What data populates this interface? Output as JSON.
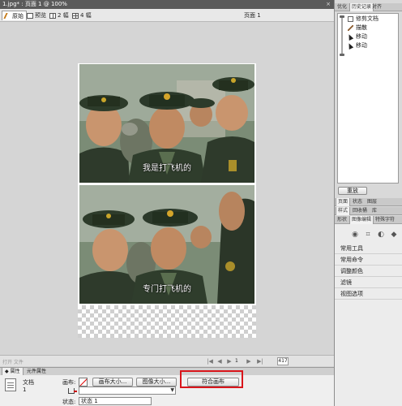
{
  "window": {
    "title": "1.jpg* : 页面 1 @ 100%",
    "close": "×"
  },
  "view_tabs": [
    {
      "label": "原始",
      "icon": "pen-icon",
      "active": true
    },
    {
      "label": "预览",
      "icon": "preview-icon"
    },
    {
      "label": "2 幅",
      "icon": "two-up-icon"
    },
    {
      "label": "4 幅",
      "icon": "four-up-icon"
    }
  ],
  "page_label": "页面 1",
  "canvas": {
    "photos": [
      {
        "caption": "我是打飞机的"
      },
      {
        "caption": "专门打飞机的"
      }
    ]
  },
  "status": {
    "left": "打开 文件",
    "page_number": "1",
    "zoom": "417",
    "nav_first": "|◀",
    "nav_prev": "◀",
    "nav_play": "▶",
    "nav_next": "▶",
    "nav_last": "▶|"
  },
  "properties": {
    "tabs": [
      {
        "label": "◆ 属性",
        "active": true
      },
      {
        "label": "元件属性"
      }
    ],
    "doc_type": "文档",
    "doc_value": "1",
    "canvas_label": "画布:",
    "canvas_size_btn": "画布大小...",
    "image_size_btn": "图像大小...",
    "fit_canvas_btn": "符合画布",
    "state_label": "状态:",
    "state_value": "状态 1"
  },
  "right_panel": {
    "top_tabs": [
      {
        "label": "优化"
      },
      {
        "label": "历史记录",
        "active": true
      },
      {
        "label": "对齐"
      }
    ],
    "history": [
      "修剪文档",
      "描散",
      "移动",
      "移动"
    ],
    "redo_btn": "重放",
    "tabs2": [
      {
        "label": "页面",
        "active": true
      },
      {
        "label": "状态"
      },
      {
        "label": "图层"
      }
    ],
    "tabs3": [
      {
        "label": "样式",
        "active": true
      },
      {
        "label": "回收桶"
      },
      {
        "label": "库"
      }
    ],
    "tabs4": [
      {
        "label": "形状"
      },
      {
        "label": "图像编辑",
        "active": true
      },
      {
        "label": "特殊字符"
      }
    ],
    "list": [
      "常用工具",
      "常用命令",
      "调整颜色",
      "滤镜",
      "视图选项"
    ]
  },
  "colors": {
    "highlight": "#d9151b",
    "canvas_bg": "#d5d5d5",
    "panel_bg": "#ececec"
  }
}
